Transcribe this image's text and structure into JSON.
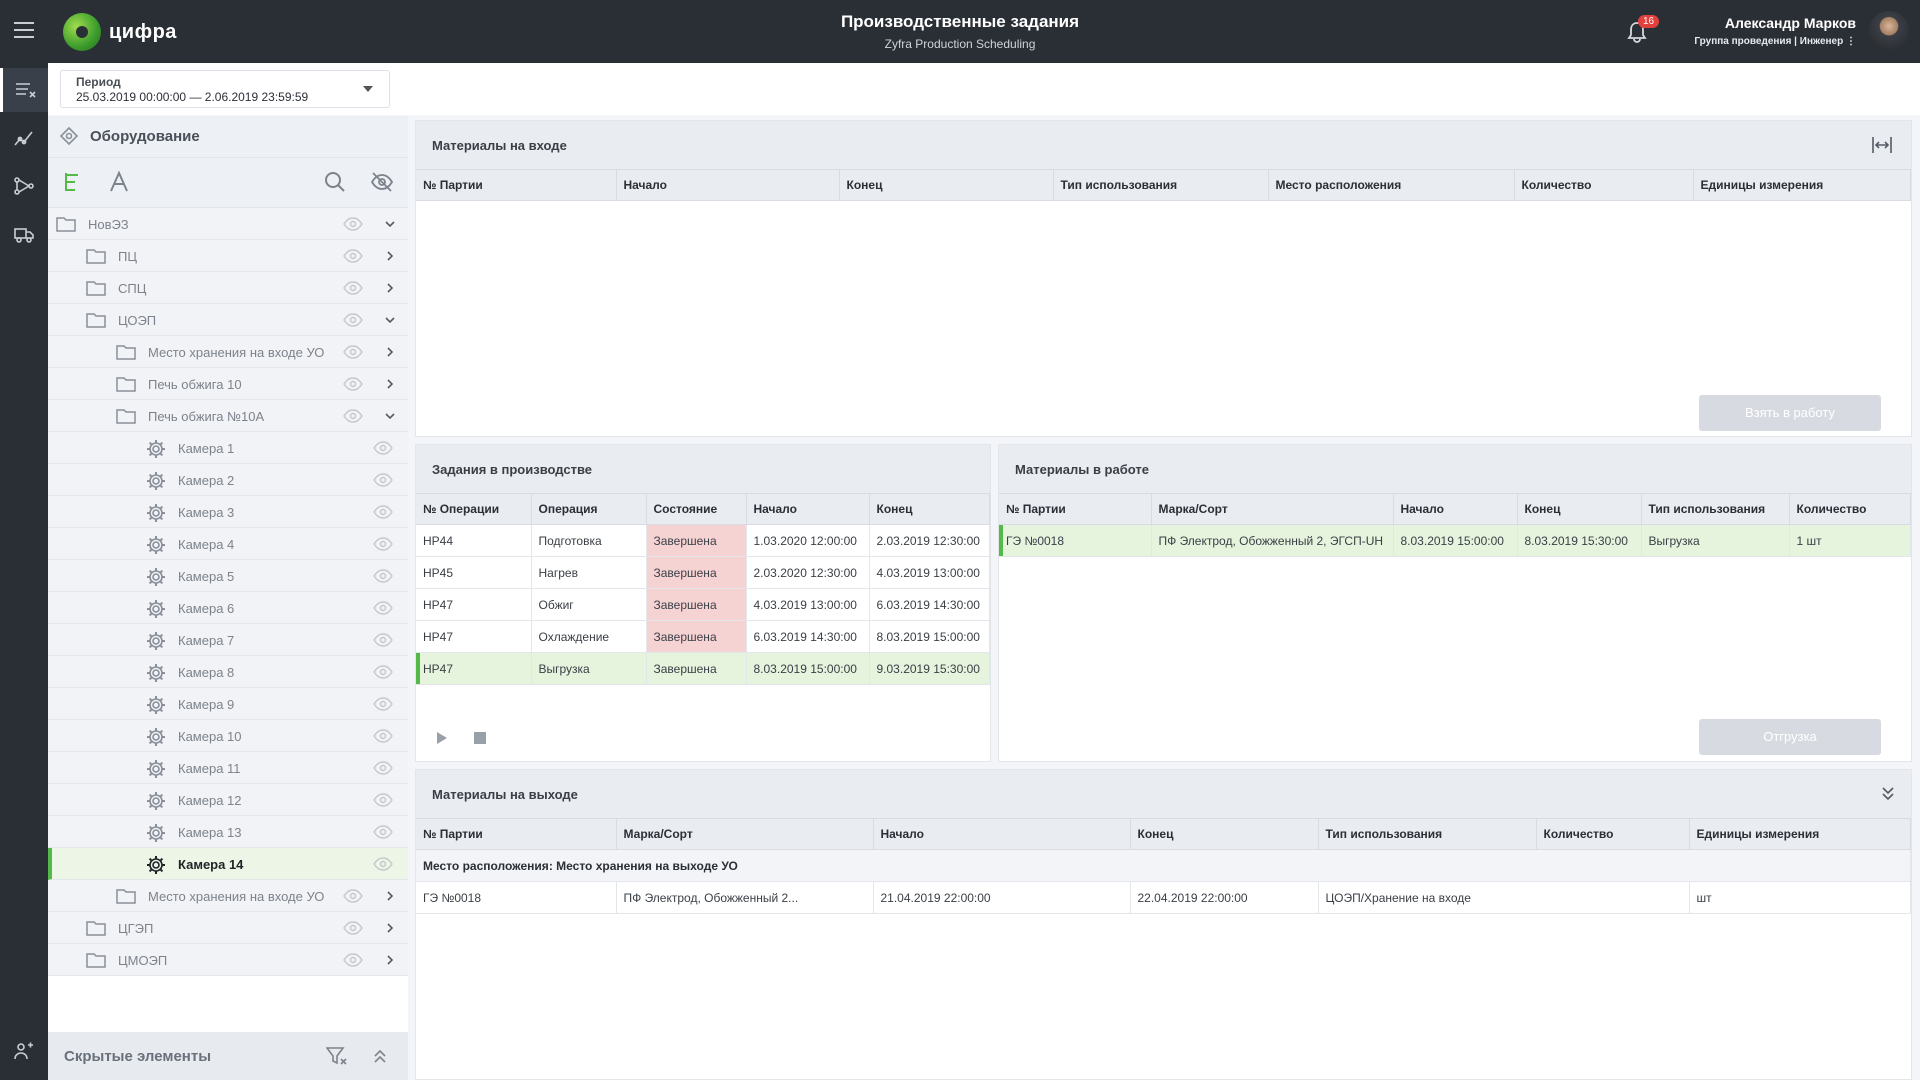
{
  "header": {
    "logo_text": "цифра",
    "title": "Производственные задания",
    "subtitle": "Zyfra Production Scheduling",
    "notifications_count": "16",
    "user_name": "Александр Марков",
    "user_group": "Группа проведения | Инженер ⋮"
  },
  "period": {
    "label": "Период",
    "value": "25.03.2019 00:00:00 — 2.06.2019 23:59:59"
  },
  "left_panel": {
    "title": "Оборудование",
    "hidden_label": "Скрытые элементы",
    "tree": [
      {
        "label": "НовЭЗ",
        "level": 0,
        "type": "folder",
        "expanded": true
      },
      {
        "label": "ПЦ",
        "level": 1,
        "type": "folder",
        "expanded": false
      },
      {
        "label": "СПЦ",
        "level": 1,
        "type": "folder",
        "expanded": false
      },
      {
        "label": "ЦОЭП",
        "level": 1,
        "type": "folder",
        "expanded": true
      },
      {
        "label": "Место хранения на входе УО",
        "level": 2,
        "type": "folder",
        "expanded": false
      },
      {
        "label": "Печь обжига 10",
        "level": 2,
        "type": "folder",
        "expanded": false
      },
      {
        "label": "Печь обжига №10А",
        "level": 2,
        "type": "folder",
        "expanded": true
      },
      {
        "label": "Камера 1",
        "level": 3,
        "type": "gear"
      },
      {
        "label": "Камера 2",
        "level": 3,
        "type": "gear"
      },
      {
        "label": "Камера 3",
        "level": 3,
        "type": "gear"
      },
      {
        "label": "Камера 4",
        "level": 3,
        "type": "gear"
      },
      {
        "label": "Камера 5",
        "level": 3,
        "type": "gear"
      },
      {
        "label": "Камера 6",
        "level": 3,
        "type": "gear"
      },
      {
        "label": "Камера 7",
        "level": 3,
        "type": "gear"
      },
      {
        "label": "Камера 8",
        "level": 3,
        "type": "gear"
      },
      {
        "label": "Камера 9",
        "level": 3,
        "type": "gear"
      },
      {
        "label": "Камера 10",
        "level": 3,
        "type": "gear"
      },
      {
        "label": "Камера 11",
        "level": 3,
        "type": "gear"
      },
      {
        "label": "Камера 12",
        "level": 3,
        "type": "gear"
      },
      {
        "label": "Камера 13",
        "level": 3,
        "type": "gear"
      },
      {
        "label": "Камера 14",
        "level": 3,
        "type": "gear",
        "active": true
      },
      {
        "label": "Место хранения на входе УО",
        "level": 2,
        "type": "folder",
        "expanded": false
      },
      {
        "label": "ЦГЭП",
        "level": 1,
        "type": "folder",
        "expanded": false
      },
      {
        "label": "ЦМОЭП",
        "level": 1,
        "type": "folder",
        "expanded": false
      }
    ]
  },
  "materials_in": {
    "title": "Материалы на входе",
    "columns": [
      "№ Партии",
      "Начало",
      "Конец",
      "Тип использования",
      "Место расположения",
      "Количество",
      "Единицы измерения"
    ],
    "rows": [],
    "button": "Взять в работу"
  },
  "tasks": {
    "title": "Задания в производстве",
    "columns": [
      "№ Операции",
      "Операция",
      "Состояние",
      "Начало",
      "Конец"
    ],
    "rows": [
      [
        "НР44",
        "Подготовка",
        "Завершена",
        "1.03.2020 12:00:00",
        "2.03.2019 12:30:00"
      ],
      [
        "НР45",
        "Нагрев",
        "Завершена",
        "2.03.2020 12:30:00",
        "4.03.2019 13:00:00"
      ],
      [
        "НР47",
        "Обжиг",
        "Завершена",
        "4.03.2019 13:00:00",
        "6.03.2019 14:30:00"
      ],
      [
        "НР47",
        "Охлаждение",
        "Завершена",
        "6.03.2019 14:30:00",
        "8.03.2019 15:00:00"
      ],
      [
        "НР47",
        "Выгрузка",
        "Завершена",
        "8.03.2019 15:00:00",
        "9.03.2019 15:30:00"
      ]
    ],
    "selected_row": 4
  },
  "materials_work": {
    "title": "Материалы в работе",
    "columns": [
      "№ Партии",
      "Марка/Сорт",
      "Начало",
      "Конец",
      "Тип использования",
      "Количество"
    ],
    "rows": [
      [
        "ГЭ №0018",
        "ПФ Электрод, Обожженный 2, ЭГСП-UH",
        "8.03.2019 15:00:00",
        "8.03.2019 15:30:00",
        "Выгрузка",
        "1 шт"
      ]
    ],
    "button": "Отгрузка"
  },
  "materials_out": {
    "title": "Материалы на выходе",
    "columns": [
      "№ Партии",
      "Марка/Сорт",
      "Начало",
      "Конец",
      "Тип использования",
      "Количество",
      "Единицы измерения"
    ],
    "group_label": "Место расположения: Место хранения на выходе УО",
    "rows": [
      [
        "ГЭ №0018",
        "ПФ Электрод, Обожженный 2...",
        "21.04.2019 22:00:00",
        "22.04.2019 22:00:00",
        "ЦОЭП/Хранение на входе",
        "",
        "шт"
      ]
    ]
  },
  "colors": {
    "accent": "#54b948",
    "topbar": "#2a2f36",
    "state_bg": "#f6d3d3",
    "selected_bg": "#e6f3dd"
  },
  "icons": [
    "menu-icon",
    "bell-icon",
    "list-icon",
    "chart-icon",
    "network-icon",
    "transport-icon",
    "users-icon",
    "equipment-icon",
    "tree-view-icon",
    "text-view-icon",
    "search-icon",
    "eye-off-icon",
    "folder-icon",
    "gear-icon",
    "eye-icon",
    "chevron-icon",
    "filter-clear-icon",
    "collapse-up-icon",
    "fit-width-icon",
    "collapse-down-icon",
    "play-icon",
    "stop-icon"
  ]
}
